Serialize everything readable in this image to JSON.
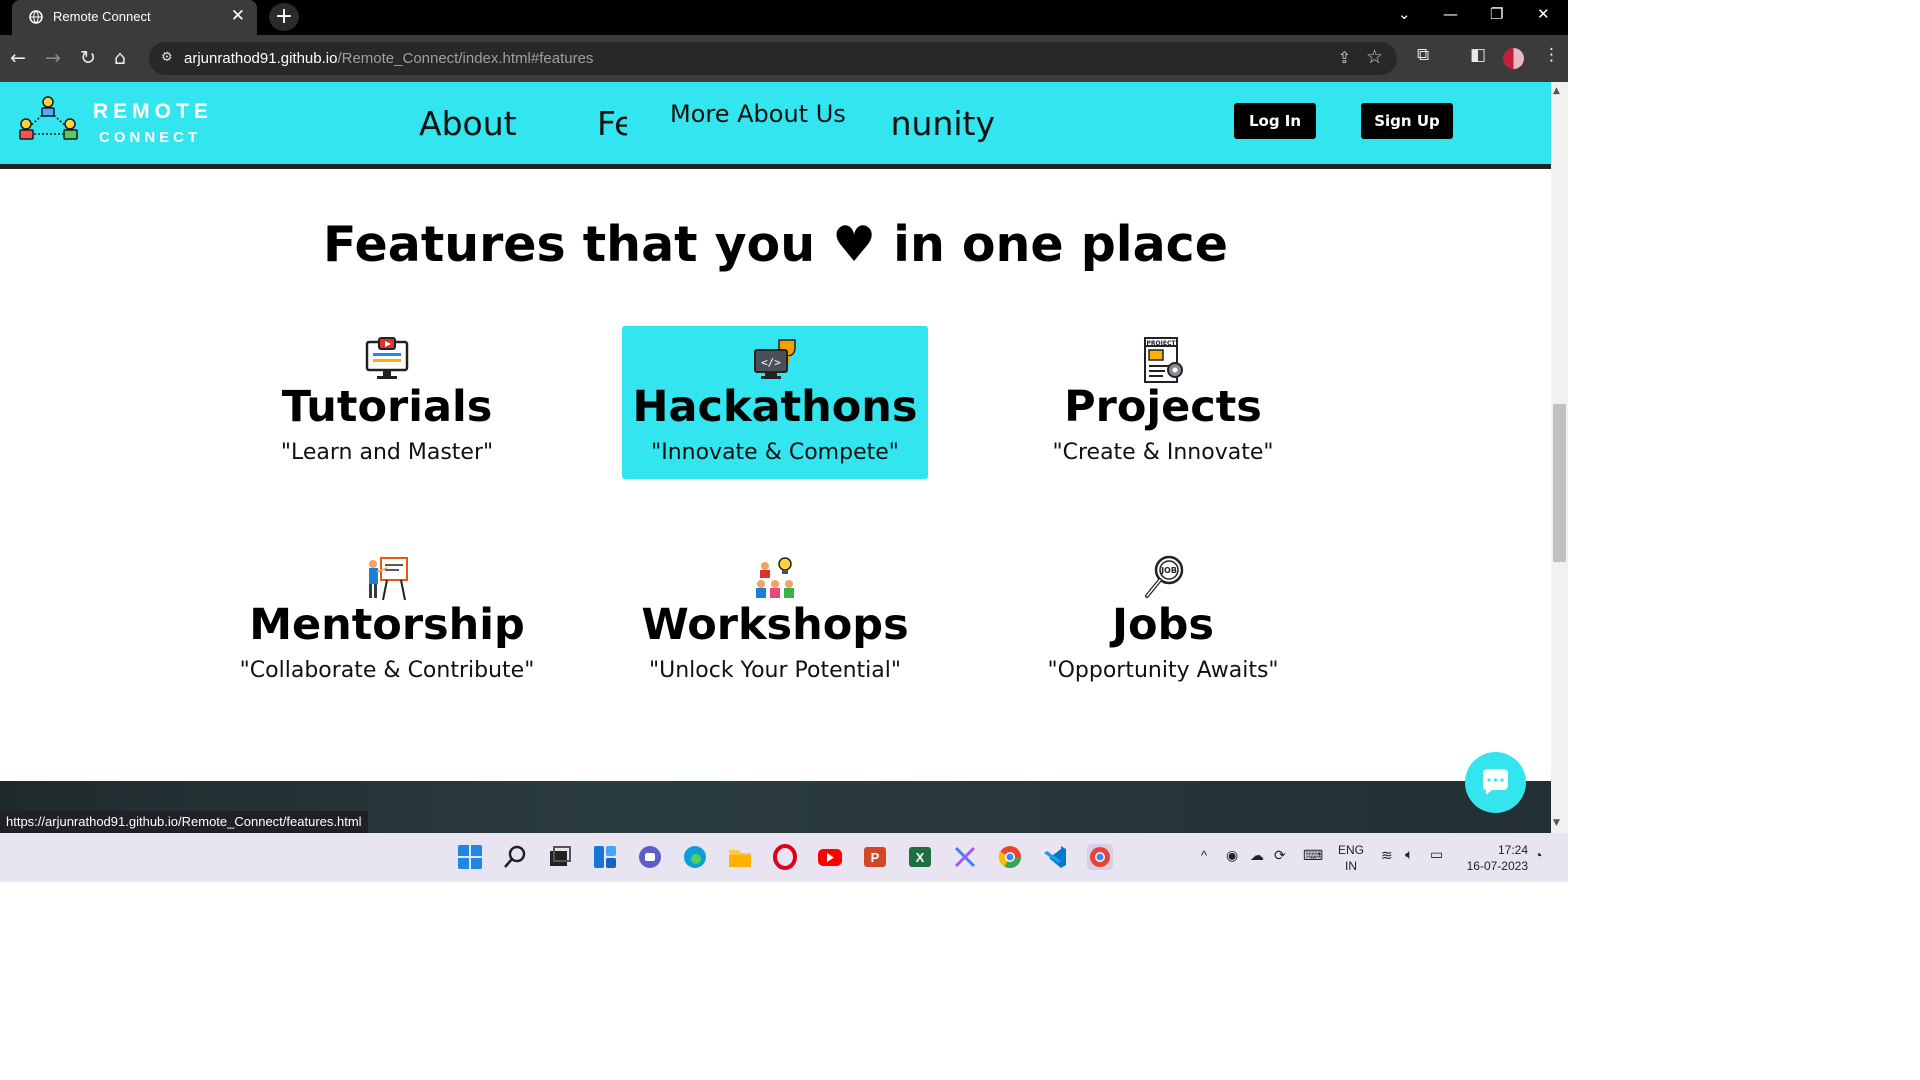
{
  "browser": {
    "tab_title": "Remote Connect",
    "url_host": "arjunrathod91.github.io",
    "url_path": "/Remote_Connect/index.html#features",
    "status_url": "https://arjunrathod91.github.io/Remote_Connect/features.html"
  },
  "header": {
    "brand_line1": "REMOTE",
    "brand_line2": "CONNECT",
    "nav_about": "About",
    "nav_features_partial": "Fe",
    "nav_more": "More About Us",
    "nav_community_partial": "nunity",
    "login_label": "Log In",
    "signup_label": "Sign Up"
  },
  "features": {
    "title": "Features that you ♥ in one place",
    "items": [
      {
        "title": "Tutorials",
        "subtitle": "\"Learn and Master\"",
        "icon": "monitor-video-icon"
      },
      {
        "title": "Hackathons",
        "subtitle": "\"Innovate & Compete\"",
        "icon": "code-trophy-icon"
      },
      {
        "title": "Projects",
        "subtitle": "\"Create & Innovate\"",
        "icon": "project-document-icon"
      },
      {
        "title": "Mentorship",
        "subtitle": "\"Collaborate & Contribute\"",
        "icon": "presenter-board-icon"
      },
      {
        "title": "Workshops",
        "subtitle": "\"Unlock Your Potential\"",
        "icon": "team-idea-icon"
      },
      {
        "title": "Jobs",
        "subtitle": "\"Opportunity Awaits\"",
        "icon": "job-search-icon"
      }
    ]
  },
  "taskbar": {
    "lang_line1": "ENG",
    "lang_line2": "IN",
    "time": "17:24",
    "date": "16-07-2023"
  },
  "colors": {
    "accent": "#33e5ef",
    "browser_frame": "#000000",
    "toolbar": "#3b3b3b",
    "button_dark": "#000000"
  }
}
